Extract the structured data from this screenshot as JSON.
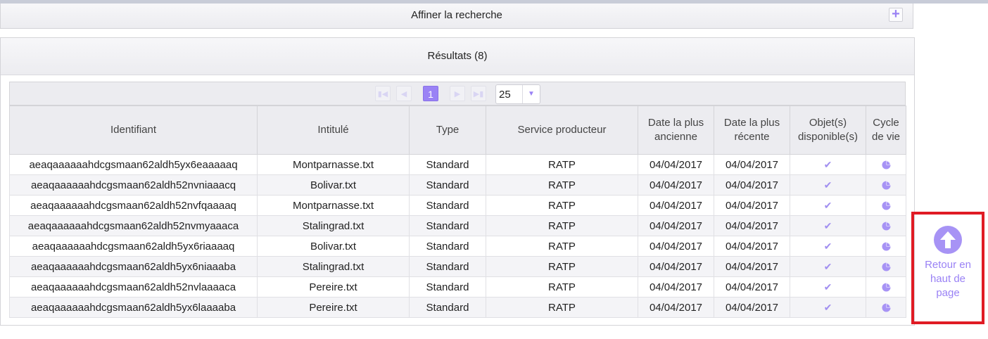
{
  "refine": {
    "title": "Affiner la recherche",
    "expand_icon": "plus-icon"
  },
  "results": {
    "title": "Résultats (8)",
    "pagination": {
      "current_page": "1",
      "per_page": "25"
    },
    "columns": [
      "Identifiant",
      "Intitulé",
      "Type",
      "Service producteur",
      "Date la plus ancienne",
      "Date la plus récente",
      "Objet(s) disponible(s)",
      "Cycle de vie"
    ],
    "rows": [
      {
        "id": "aeaqaaaaaahdcgsmaan62aldh5yx6eaaaaaq",
        "title": "Montparnasse.txt",
        "type": "Standard",
        "service": "RATP",
        "date_old": "04/04/2017",
        "date_new": "04/04/2017"
      },
      {
        "id": "aeaqaaaaaahdcgsmaan62aldh52nvniaaacq",
        "title": "Bolivar.txt",
        "type": "Standard",
        "service": "RATP",
        "date_old": "04/04/2017",
        "date_new": "04/04/2017"
      },
      {
        "id": "aeaqaaaaaahdcgsmaan62aldh52nvfqaaaaq",
        "title": "Montparnasse.txt",
        "type": "Standard",
        "service": "RATP",
        "date_old": "04/04/2017",
        "date_new": "04/04/2017"
      },
      {
        "id": "aeaqaaaaaahdcgsmaan62aldh52nvmyaaaca",
        "title": "Stalingrad.txt",
        "type": "Standard",
        "service": "RATP",
        "date_old": "04/04/2017",
        "date_new": "04/04/2017"
      },
      {
        "id": "aeaqaaaaaahdcgsmaan62aldh5yx6riaaaaq",
        "title": "Bolivar.txt",
        "type": "Standard",
        "service": "RATP",
        "date_old": "04/04/2017",
        "date_new": "04/04/2017"
      },
      {
        "id": "aeaqaaaaaahdcgsmaan62aldh5yx6niaaaba",
        "title": "Stalingrad.txt",
        "type": "Standard",
        "service": "RATP",
        "date_old": "04/04/2017",
        "date_new": "04/04/2017"
      },
      {
        "id": "aeaqaaaaaahdcgsmaan62aldh52nvlaaaaca",
        "title": "Pereire.txt",
        "type": "Standard",
        "service": "RATP",
        "date_old": "04/04/2017",
        "date_new": "04/04/2017"
      },
      {
        "id": "aeaqaaaaaahdcgsmaan62aldh5yx6laaaaba",
        "title": "Pereire.txt",
        "type": "Standard",
        "service": "RATP",
        "date_old": "04/04/2017",
        "date_new": "04/04/2017"
      }
    ]
  },
  "back_to_top": {
    "label": "Retour en haut de page"
  },
  "colors": {
    "accent": "#9a82f5",
    "highlight_border": "#e01b24"
  }
}
